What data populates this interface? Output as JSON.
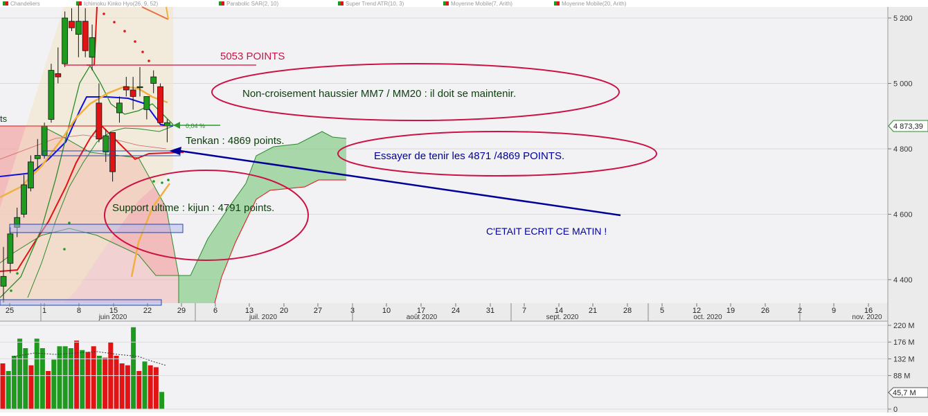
{
  "colors": {
    "bg_plot": "#f2f2f5",
    "axis_bg": "#ebebeb",
    "bull": "#1e9a1e",
    "bear": "#e01414",
    "tenkan": "#1010dd",
    "kijun": "#e01414",
    "mm7": "#2a8a2a",
    "mm20": "#f0b040",
    "annot_red": "#cc1144",
    "annot_blue": "#000099",
    "annot_green": "#0d3d0d",
    "kumo_green": "#8fce8f",
    "kumo_red": "#f1a8a8"
  },
  "legend": {
    "items": [
      "Chandeliers",
      "Ichimoku Kinko Hyo(26, 9, 52)",
      "Parabolic SAR(2, 10)",
      "Super Trend ATR(10, 3)",
      "Moyenne Mobile(7, Arith)",
      "Moyenne Mobile(20, Arith)"
    ]
  },
  "chart_data": {
    "type": "candlestick",
    "title": "",
    "price_axis": {
      "ticks": [
        "5 200",
        "5 000",
        "4 800",
        "4 600",
        "4 400"
      ],
      "range": [
        4330,
        5245
      ]
    },
    "current_price_label": "4 873,39",
    "change_label": "0,04 %",
    "left_clip_label": "ts",
    "time_axis": {
      "day_ticks": [
        "25",
        "1",
        "8",
        "15",
        "22",
        "29",
        "6",
        "13",
        "20",
        "27",
        "3",
        "10",
        "17",
        "24",
        "31",
        "7",
        "14",
        "21",
        "28",
        "5",
        "12",
        "19",
        "26",
        "2",
        "9",
        "16"
      ],
      "months": [
        "juin 2020",
        "juil. 2020",
        "août 2020",
        "sept. 2020",
        "oct. 2020",
        "nov. 2020"
      ]
    },
    "candles": [
      {
        "o": 4380,
        "h": 4500,
        "l": 4330,
        "c": 4410
      },
      {
        "o": 4450,
        "h": 4560,
        "l": 4420,
        "c": 4540
      },
      {
        "o": 4560,
        "h": 4620,
        "l": 4530,
        "c": 4590
      },
      {
        "o": 4600,
        "h": 4720,
        "l": 4590,
        "c": 4690
      },
      {
        "o": 4680,
        "h": 4780,
        "l": 4670,
        "c": 4760
      },
      {
        "o": 4770,
        "h": 4830,
        "l": 4740,
        "c": 4780
      },
      {
        "o": 4780,
        "h": 4880,
        "l": 4770,
        "c": 4870
      },
      {
        "o": 4890,
        "h": 5060,
        "l": 4880,
        "c": 5040
      },
      {
        "o": 5030,
        "h": 5110,
        "l": 5000,
        "c": 5020
      },
      {
        "o": 5060,
        "h": 5220,
        "l": 5050,
        "c": 5200
      },
      {
        "o": 5190,
        "h": 5230,
        "l": 5160,
        "c": 5170
      },
      {
        "o": 5150,
        "h": 5240,
        "l": 5080,
        "c": 5190
      },
      {
        "o": 5190,
        "h": 5230,
        "l": 5080,
        "c": 5100
      },
      {
        "o": 5080,
        "h": 5180,
        "l": 5040,
        "c": 5140
      },
      {
        "o": 4940,
        "h": 5000,
        "l": 4820,
        "c": 4830
      },
      {
        "o": 4790,
        "h": 4860,
        "l": 4760,
        "c": 4840
      },
      {
        "o": 4850,
        "h": 4850,
        "l": 4700,
        "c": 4730
      },
      {
        "o": 4910,
        "h": 4960,
        "l": 4880,
        "c": 4940
      },
      {
        "o": 4990,
        "h": 5020,
        "l": 4960,
        "c": 4980
      },
      {
        "o": 4980,
        "h": 5020,
        "l": 4920,
        "c": 4960
      },
      {
        "o": 4990,
        "h": 5050,
        "l": 4960,
        "c": 4990
      },
      {
        "o": 4920,
        "h": 4960,
        "l": 4890,
        "c": 4960
      },
      {
        "o": 5000,
        "h": 5040,
        "l": 4970,
        "c": 5020
      },
      {
        "o": 4990,
        "h": 5000,
        "l": 4880,
        "c": 4880
      },
      {
        "o": 4870,
        "h": 4890,
        "l": 4820,
        "c": 4880
      }
    ],
    "volume_axis": {
      "ticks": [
        "220 M",
        "176 M",
        "132 M",
        "88 M",
        "0"
      ],
      "max": 220,
      "current_label": "45,7 M"
    },
    "volumes": [
      {
        "v": 120,
        "up": false
      },
      {
        "v": 100,
        "up": true
      },
      {
        "v": 140,
        "up": true
      },
      {
        "v": 185,
        "up": true
      },
      {
        "v": 160,
        "up": true
      },
      {
        "v": 115,
        "up": false
      },
      {
        "v": 185,
        "up": true
      },
      {
        "v": 160,
        "up": true
      },
      {
        "v": 100,
        "up": false
      },
      {
        "v": 130,
        "up": true
      },
      {
        "v": 165,
        "up": true
      },
      {
        "v": 165,
        "up": true
      },
      {
        "v": 160,
        "up": true
      },
      {
        "v": 180,
        "up": false
      },
      {
        "v": 155,
        "up": true
      },
      {
        "v": 150,
        "up": false
      },
      {
        "v": 165,
        "up": false
      },
      {
        "v": 140,
        "up": true
      },
      {
        "v": 135,
        "up": false
      },
      {
        "v": 175,
        "up": false
      },
      {
        "v": 140,
        "up": false
      },
      {
        "v": 120,
        "up": false
      },
      {
        "v": 115,
        "up": false
      },
      {
        "v": 215,
        "up": true
      },
      {
        "v": 100,
        "up": false
      },
      {
        "v": 125,
        "up": true
      },
      {
        "v": 115,
        "up": false
      },
      {
        "v": 110,
        "up": false
      },
      {
        "v": 45,
        "up": true
      }
    ]
  },
  "annotations": {
    "points_5053": "5053 POINTS",
    "non_croisement": "Non-croisement haussier MM7 / MM20 : il doit se maintenir.",
    "tenkan": "Tenkan : 4869 points.",
    "essayer": "Essayer de tenir les 4871  /4869 POINTS.",
    "support": "Support ultime : kijun : 4791 points.",
    "cetait": "C'ETAIT ECRIT CE MATIN !"
  }
}
